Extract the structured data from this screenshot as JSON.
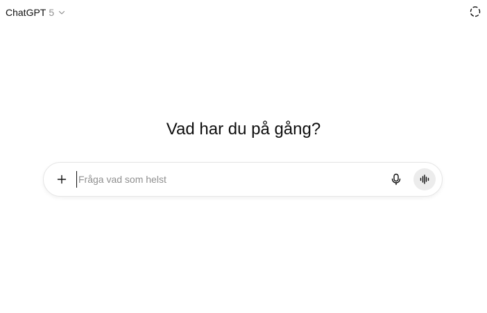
{
  "header": {
    "model_name": "ChatGPT",
    "model_version": "5",
    "chevron_icon": "chevron-down-icon",
    "temporary_chat_icon": "dashed-circle-icon"
  },
  "main": {
    "headline": "Vad har du på gång?"
  },
  "composer": {
    "placeholder": "Fråga vad som helst",
    "value": "",
    "attach_icon": "plus-icon",
    "dictate_icon": "microphone-icon",
    "voice_mode_icon": "waveform-icon"
  },
  "colors": {
    "text": "#0d0d0d",
    "muted": "#8f8f8f",
    "composer_border": "#e5e5e5",
    "voice_button_bg": "#ececec"
  }
}
